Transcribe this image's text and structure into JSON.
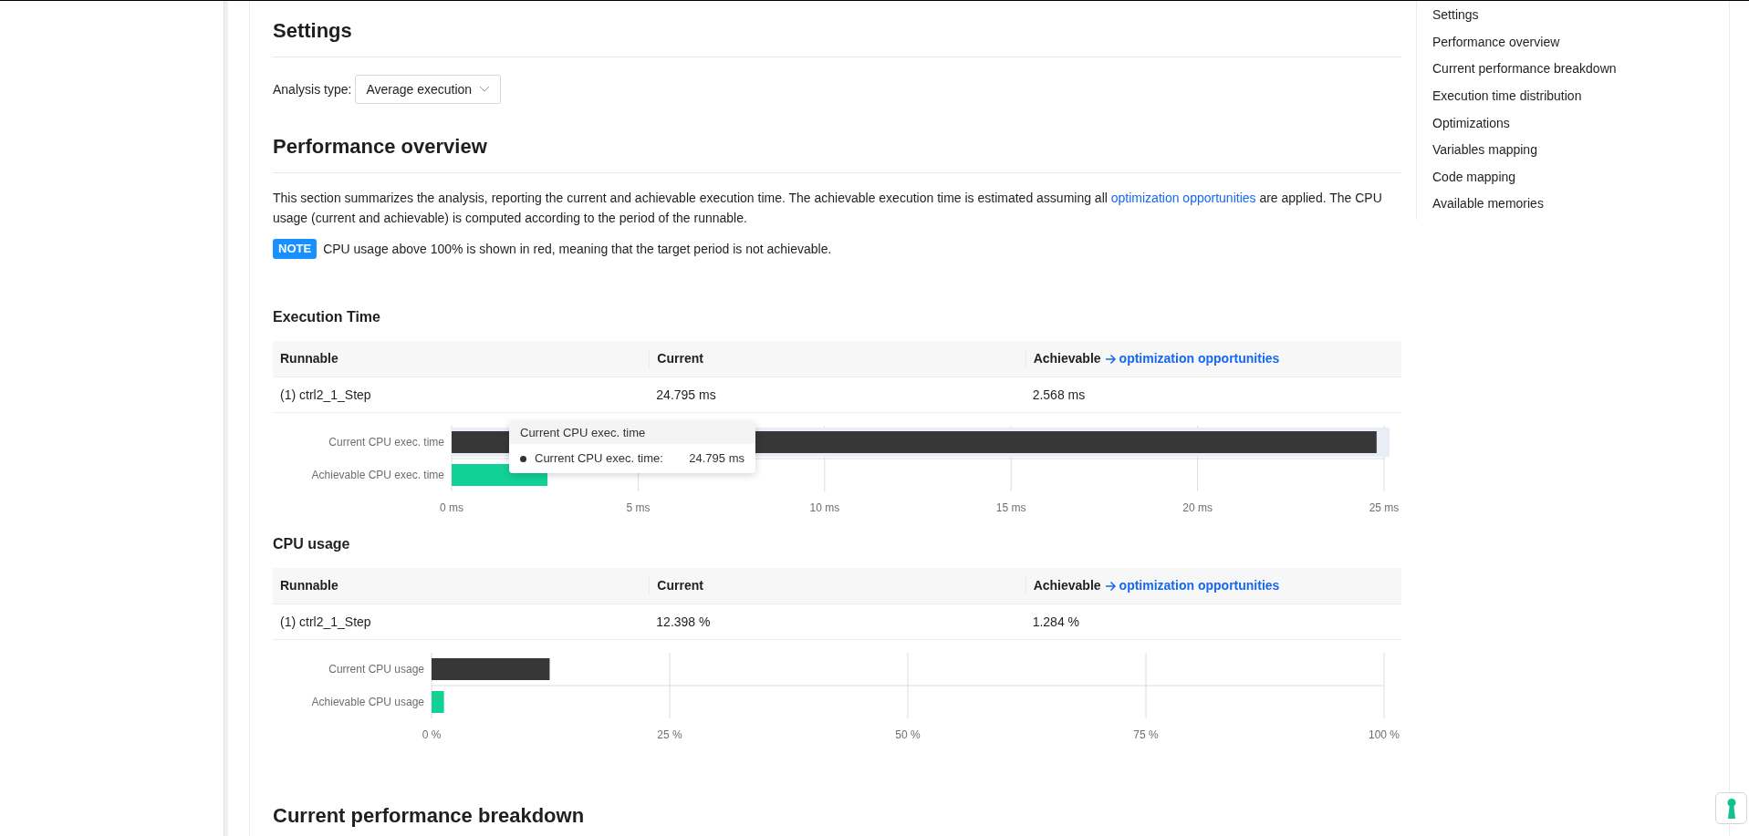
{
  "settings": {
    "heading": "Settings",
    "analysis_label": "Analysis type:",
    "analysis_value": "Average execution"
  },
  "overview": {
    "heading": "Performance overview",
    "paragraph": [
      "This section summarizes the analysis, reporting the current and achievable execution time. The achievable execution time is estimated assuming all ",
      "optimization opportunities",
      " are applied. The CPU usage (current and achievable) is computed according to the period of the runnable."
    ],
    "note_badge": "NOTE",
    "note_text": "CPU usage above 100% is shown in red, meaning that the target period is not achievable."
  },
  "sections": [
    {
      "heading": "Execution Time",
      "columns": [
        "Runnable",
        "Current",
        "Achievable"
      ],
      "column_link": "optimization opportunities",
      "rows": [
        [
          "(1) ctrl2_1_Step",
          "24.795 ms",
          "2.568 ms"
        ]
      ],
      "chart_data": {
        "type": "bar",
        "orientation": "horizontal",
        "grid": true,
        "categories": [
          "Current CPU exec. time",
          "Achievable CPU exec. time"
        ],
        "series": [
          {
            "color": "#373737",
            "values": [
              24.8,
              null
            ]
          },
          {
            "color": "#12d196",
            "values": [
              null,
              2.57
            ]
          }
        ],
        "xlim": [
          0,
          25
        ],
        "xticks": [
          {
            "value": 0,
            "label": "0 ms"
          },
          {
            "value": 5,
            "label": "5 ms"
          },
          {
            "value": 10,
            "label": "10 ms"
          },
          {
            "value": 15,
            "label": "15 ms"
          },
          {
            "value": 20,
            "label": "20 ms"
          },
          {
            "value": 25,
            "label": "25 ms"
          }
        ]
      },
      "tooltip": {
        "title": "Current CPU exec. time",
        "label": "Current CPU exec. time:",
        "value": "24.795 ms"
      }
    },
    {
      "heading": "CPU usage",
      "columns": [
        "Runnable",
        "Current",
        "Achievable"
      ],
      "column_link": "optimization opportunities",
      "rows": [
        [
          "(1) ctrl2_1_Step",
          "12.398 %",
          "1.284 %"
        ]
      ],
      "chart_data": {
        "type": "bar",
        "orientation": "horizontal",
        "grid": true,
        "categories": [
          "Current CPU usage",
          "Achievable CPU usage"
        ],
        "series": [
          {
            "color": "#373737",
            "values": [
              12.4,
              null
            ]
          },
          {
            "color": "#12d196",
            "values": [
              null,
              1.3
            ]
          }
        ],
        "xlim": [
          0,
          100
        ],
        "xticks": [
          {
            "value": 0,
            "label": "0 %"
          },
          {
            "value": 25,
            "label": "25 %"
          },
          {
            "value": 50,
            "label": "50 %"
          },
          {
            "value": 75,
            "label": "75 %"
          },
          {
            "value": 100,
            "label": "100 %"
          }
        ]
      }
    }
  ],
  "next_heading": "Current performance breakdown",
  "toc": [
    "Settings",
    "Performance overview",
    "Current performance breakdown",
    "Execution time distribution",
    "Optimizations",
    "Variables mapping",
    "Code mapping",
    "Available memories"
  ]
}
